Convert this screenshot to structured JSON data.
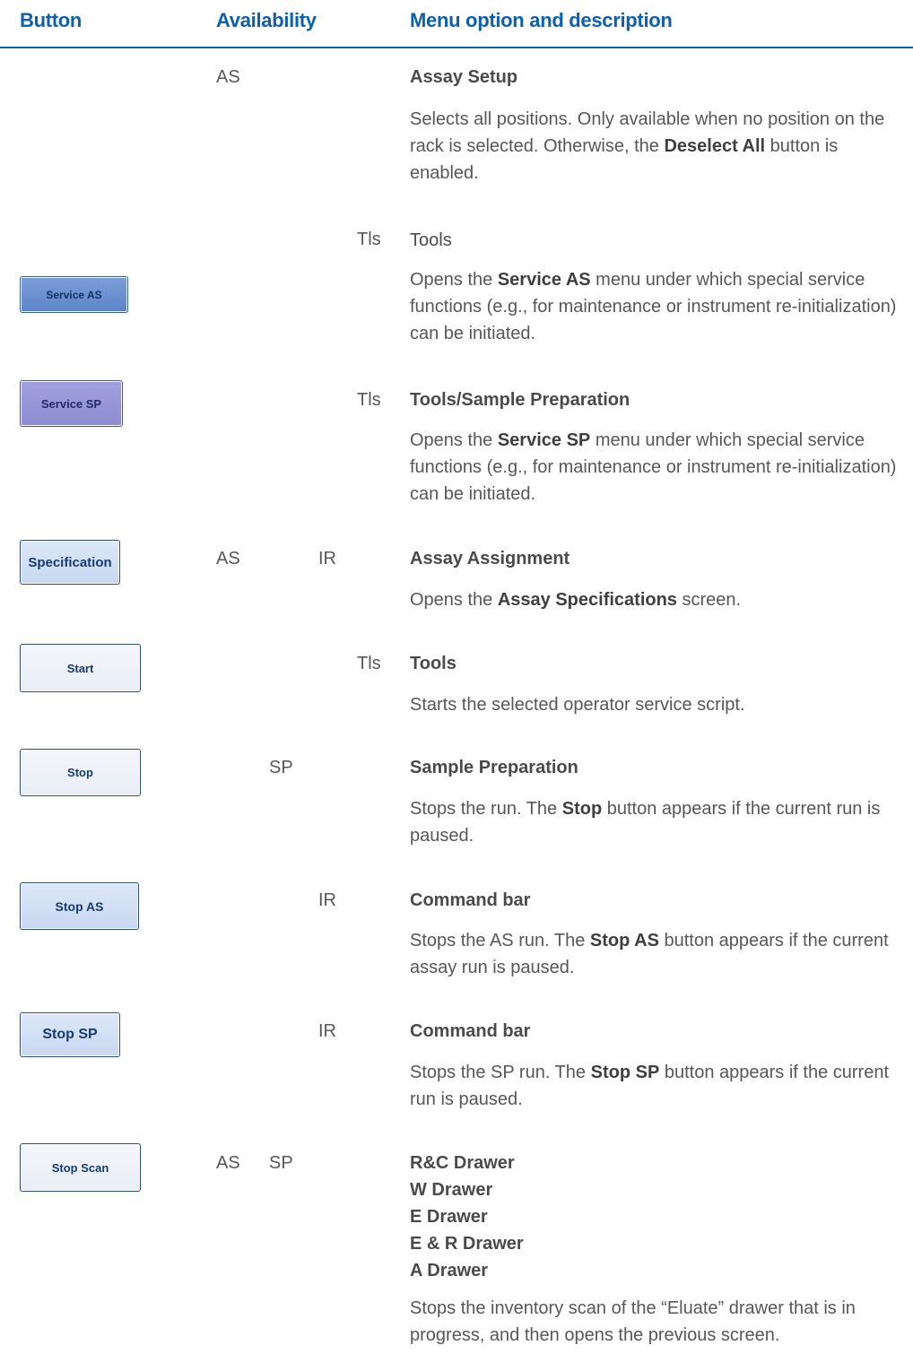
{
  "header": {
    "col_button": "Button",
    "col_availability": "Availability",
    "col_menu": "Menu option and description"
  },
  "rows": [
    {
      "button": "",
      "availability": [
        "AS"
      ],
      "title": "Assay Setup",
      "description": [
        "Selects all positions. Only available when no position on the rack is selected. Otherwise, the ",
        "Deselect All",
        " button is enabled."
      ]
    },
    {
      "button": "Service AS",
      "availability": [
        "Tls"
      ],
      "title": "Tools",
      "description": [
        "Opens the ",
        "Service AS",
        " menu under which special service functions (e.g., for maintenance or instrument re-initialization) can be initiated."
      ]
    },
    {
      "button": "Service SP",
      "availability": [
        "Tls"
      ],
      "title": "Tools/Sample Preparation",
      "description": [
        "Opens the ",
        "Service SP",
        " menu under which special service functions (e.g., for maintenance or instrument re-initialization) can be initiated."
      ]
    },
    {
      "button": "Specification",
      "availability": [
        "AS",
        "IR"
      ],
      "title": "Assay Assignment",
      "description": [
        "Opens the ",
        "Assay Specifications",
        " screen."
      ]
    },
    {
      "button": "Start",
      "availability": [
        "Tls"
      ],
      "title": "Tools",
      "description": [
        "Starts the selected operator service script."
      ]
    },
    {
      "button": "Stop",
      "availability": [
        "SP"
      ],
      "title": "Sample Preparation",
      "description": [
        "Stops the run. The ",
        "Stop",
        " button appears if the current run is paused."
      ]
    },
    {
      "button": "Stop AS",
      "availability": [
        "IR"
      ],
      "title": "Command bar",
      "description": [
        "Stops the AS run. The ",
        "Stop AS",
        " button appears if the current assay run is paused."
      ]
    },
    {
      "button": "Stop SP",
      "availability": [
        "IR"
      ],
      "title": "Command bar",
      "description": [
        "Stops the SP run. The ",
        "Stop SP",
        " button appears if the current run is paused."
      ]
    },
    {
      "button": "Stop Scan",
      "availability": [
        "AS",
        "SP"
      ],
      "titles": [
        "R&C Drawer",
        "W Drawer",
        "E Drawer",
        "E & R Drawer",
        "A Drawer"
      ],
      "description": [
        "Stops the inventory scan of the “Eluate” drawer that is in progress, and then opens the previous screen."
      ]
    }
  ]
}
